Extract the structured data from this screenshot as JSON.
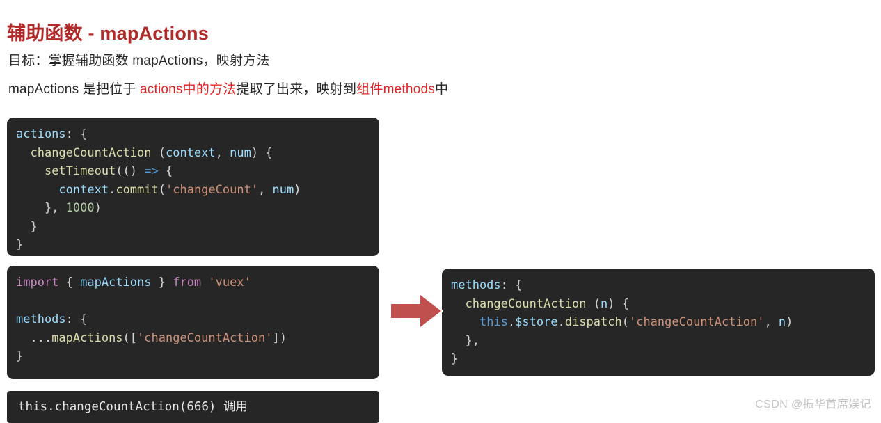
{
  "slide": {
    "title": "辅助函数 - mapActions",
    "title_color": "#b12a2a",
    "background": "#ffffff"
  },
  "intro": {
    "line1": "目标：掌握辅助函数 mapActions，映射方法",
    "line2_part1": "mapActions 是把位于 ",
    "line2_highlight1": "actions中的方法",
    "line2_part2": "提取了出来，映射到",
    "line2_highlight2": "组件methods",
    "line2_part3": "中",
    "highlight_color": "#e02424"
  },
  "code_blocks": {
    "actions": {
      "name": "actions-definition",
      "background": "#262626",
      "lines": [
        [
          {
            "t": "actions",
            "c": "t-var"
          },
          {
            "t": ": {",
            "c": "t-punc"
          }
        ],
        [
          {
            "t": "  ",
            "c": "t-punc"
          },
          {
            "t": "changeCountAction",
            "c": "t-fn"
          },
          {
            "t": " (",
            "c": "t-punc"
          },
          {
            "t": "context",
            "c": "t-var"
          },
          {
            "t": ", ",
            "c": "t-punc"
          },
          {
            "t": "num",
            "c": "t-var"
          },
          {
            "t": ") {",
            "c": "t-punc"
          }
        ],
        [
          {
            "t": "    ",
            "c": "t-punc"
          },
          {
            "t": "setTimeout",
            "c": "t-fn"
          },
          {
            "t": "(() ",
            "c": "t-punc"
          },
          {
            "t": "=>",
            "c": "t-key"
          },
          {
            "t": " {",
            "c": "t-punc"
          }
        ],
        [
          {
            "t": "      ",
            "c": "t-punc"
          },
          {
            "t": "context",
            "c": "t-var"
          },
          {
            "t": ".",
            "c": "t-punc"
          },
          {
            "t": "commit",
            "c": "t-fn"
          },
          {
            "t": "(",
            "c": "t-punc"
          },
          {
            "t": "'changeCount'",
            "c": "t-str"
          },
          {
            "t": ", ",
            "c": "t-punc"
          },
          {
            "t": "num",
            "c": "t-var"
          },
          {
            "t": ")",
            "c": "t-punc"
          }
        ],
        [
          {
            "t": "    }, ",
            "c": "t-punc"
          },
          {
            "t": "1000",
            "c": "t-num"
          },
          {
            "t": ")",
            "c": "t-punc"
          }
        ],
        [
          {
            "t": "  }",
            "c": "t-punc"
          }
        ],
        [
          {
            "t": "}",
            "c": "t-punc"
          }
        ]
      ]
    },
    "import_map": {
      "name": "mapactions-usage",
      "background": "#262626",
      "lines": [
        [
          {
            "t": "import",
            "c": "t-kw"
          },
          {
            "t": " { ",
            "c": "t-punc"
          },
          {
            "t": "mapActions",
            "c": "t-var"
          },
          {
            "t": " } ",
            "c": "t-punc"
          },
          {
            "t": "from",
            "c": "t-kw"
          },
          {
            "t": " ",
            "c": "t-punc"
          },
          {
            "t": "'vuex'",
            "c": "t-str"
          }
        ],
        [
          {
            "t": "",
            "c": "t-punc"
          }
        ],
        [
          {
            "t": "methods",
            "c": "t-var"
          },
          {
            "t": ": {",
            "c": "t-punc"
          }
        ],
        [
          {
            "t": "  ...",
            "c": "t-punc"
          },
          {
            "t": "mapActions",
            "c": "t-fn"
          },
          {
            "t": "([",
            "c": "t-punc"
          },
          {
            "t": "'changeCountAction'",
            "c": "t-str"
          },
          {
            "t": "])",
            "c": "t-punc"
          }
        ],
        [
          {
            "t": "}",
            "c": "t-punc"
          }
        ]
      ]
    },
    "methods_expanded": {
      "name": "expanded-methods",
      "background": "#262626",
      "lines": [
        [
          {
            "t": "methods",
            "c": "t-var"
          },
          {
            "t": ": {",
            "c": "t-punc"
          }
        ],
        [
          {
            "t": "  ",
            "c": "t-punc"
          },
          {
            "t": "changeCountAction",
            "c": "t-fn"
          },
          {
            "t": " (",
            "c": "t-punc"
          },
          {
            "t": "n",
            "c": "t-var"
          },
          {
            "t": ") {",
            "c": "t-punc"
          }
        ],
        [
          {
            "t": "    ",
            "c": "t-punc"
          },
          {
            "t": "this",
            "c": "t-key"
          },
          {
            "t": ".",
            "c": "t-punc"
          },
          {
            "t": "$store",
            "c": "t-var"
          },
          {
            "t": ".",
            "c": "t-punc"
          },
          {
            "t": "dispatch",
            "c": "t-fn"
          },
          {
            "t": "(",
            "c": "t-punc"
          },
          {
            "t": "'changeCountAction'",
            "c": "t-str"
          },
          {
            "t": ", ",
            "c": "t-punc"
          },
          {
            "t": "n",
            "c": "t-var"
          },
          {
            "t": ")",
            "c": "t-punc"
          }
        ],
        [
          {
            "t": "  },",
            "c": "t-punc"
          }
        ],
        [
          {
            "t": "}",
            "c": "t-punc"
          }
        ]
      ]
    },
    "call_example": {
      "name": "call-example",
      "background": "#262626",
      "lines": [
        [
          {
            "t": "this.changeCountAction(666) 调用",
            "c": "t-plain"
          }
        ]
      ]
    }
  },
  "arrow": {
    "icon": "right-arrow-icon",
    "fill": "#c0504d",
    "stroke": "#ffffff",
    "direction": "right"
  },
  "watermark": {
    "text": "CSDN @振华首席娱记",
    "color": "#c3c3c3"
  }
}
